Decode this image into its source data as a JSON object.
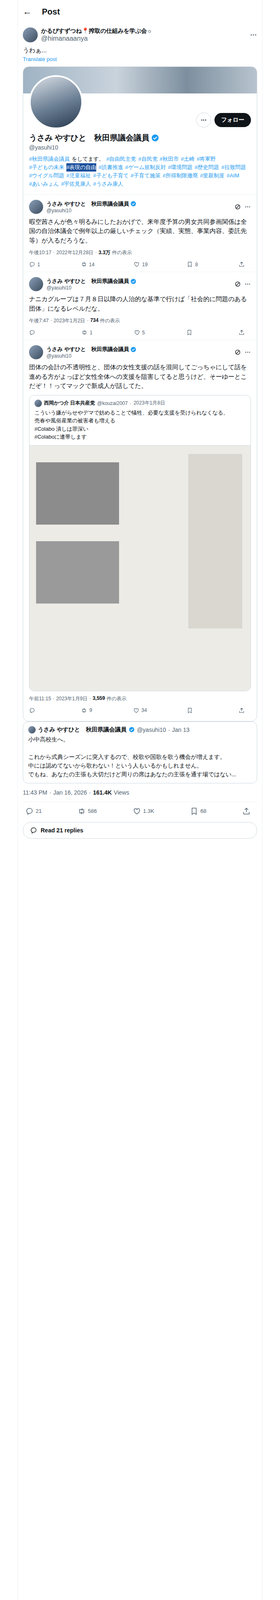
{
  "header": {
    "back": "←",
    "title": "Post"
  },
  "post": {
    "author": {
      "name": "かるぴすずつね📍搾取の仕組みを学ぶ会☼",
      "handle": "@himanaaanya"
    },
    "text": "うわぁ...",
    "translate": "Translate post",
    "embed": {
      "profile": {
        "name": "うさみ やすひと　秋田県議会議員",
        "verified": true,
        "handle": "@yasuhi10",
        "follow": "フォロー",
        "bio": [
          {
            "text": "#秋田県議会議員",
            "kind": "hashtag",
            "selected": false
          },
          {
            "text": "をしてます。",
            "kind": "plain",
            "selected": false
          },
          {
            "text": "#自由民主党",
            "kind": "hashtag",
            "selected": false
          },
          {
            "text": "#自民党",
            "kind": "hashtag",
            "selected": false
          },
          {
            "text": "#秋田市",
            "kind": "hashtag",
            "selected": false
          },
          {
            "text": "#土崎",
            "kind": "hashtag",
            "selected": false
          },
          {
            "text": "#将軍野",
            "kind": "hashtag",
            "selected": false
          },
          {
            "text": "#子どもの未来",
            "kind": "hashtag",
            "selected": false
          },
          {
            "text": "#表現の自由",
            "kind": "hashtag",
            "selected": true
          },
          {
            "text": "#読書推進",
            "kind": "hashtag",
            "selected": false
          },
          {
            "text": "#ゲーム規制反対",
            "kind": "hashtag",
            "selected": false
          },
          {
            "text": "#環境問題",
            "kind": "hashtag",
            "selected": false
          },
          {
            "text": "#歴史問題",
            "kind": "hashtag",
            "selected": false
          },
          {
            "text": "#拉致問題",
            "kind": "hashtag",
            "selected": false
          },
          {
            "text": "#ウイグル問題",
            "kind": "hashtag",
            "selected": false
          },
          {
            "text": "#児童福祉",
            "kind": "hashtag",
            "selected": false
          },
          {
            "text": "#子ども子育て",
            "kind": "hashtag",
            "selected": false
          },
          {
            "text": "#子育て施策",
            "kind": "hashtag",
            "selected": false
          },
          {
            "text": "#所得制限撤廃",
            "kind": "hashtag",
            "selected": false
          },
          {
            "text": "#里親制度",
            "kind": "hashtag",
            "selected": false
          },
          {
            "text": "#AIM",
            "kind": "hashtag",
            "selected": false
          },
          {
            "text": "#あいみょん",
            "kind": "hashtag",
            "selected": false
          },
          {
            "text": "#宇佐見康人",
            "kind": "hashtag",
            "selected": false
          },
          {
            "text": "#うさみ康人",
            "kind": "hashtag",
            "selected": false
          }
        ]
      },
      "tweets": [
        {
          "name": "うさみ やすひと　秋田県議会議員",
          "verified": true,
          "handle": "@yasuhi10",
          "text": "暇空茜さんが色々明るみにしたおかげで、来年度予算の男女共同参画関係は全国の自治体議会で例年以上の厳しいチェック（実績、実態、事業内容、委託先等）が入るだろうな。",
          "meta": [
            "午後10:17",
            "·",
            "2022年12月28日",
            "·"
          ],
          "views": "3.3万",
          "views_label": "件の表示",
          "quote": null,
          "actions": [
            {
              "kind": "reply",
              "count": "1"
            },
            {
              "kind": "repost",
              "count": "14"
            },
            {
              "kind": "like",
              "count": "19"
            },
            {
              "kind": "bookmark",
              "count": "8"
            },
            {
              "kind": "share",
              "count": ""
            }
          ]
        },
        {
          "name": "うさみ やすひと　秋田県議会議員",
          "verified": true,
          "handle": "@yasuhi10",
          "text": "ナニカグループは７月８日以降の人治的な基準で行けば「社会的に問題のある団体」になるレベルだな。",
          "meta": [
            "午後7:47",
            "·",
            "2023年1月2日",
            "·"
          ],
          "views": "734",
          "views_label": "件の表示",
          "quote": null,
          "actions": [
            {
              "kind": "reply",
              "count": ""
            },
            {
              "kind": "repost",
              "count": "1"
            },
            {
              "kind": "like",
              "count": "5"
            },
            {
              "kind": "bookmark",
              "count": ""
            },
            {
              "kind": "share",
              "count": ""
            }
          ]
        },
        {
          "name": "うさみ やすひと　秋田県議会議員",
          "verified": true,
          "handle": "@yasuhi10",
          "text": "団体の会計の不透明性と、団体の女性支援の話を混同してごっちゃにして話を進める方がよっぽど女性全体への支援を阻害してると思うけど、そーゆーとこだぞ！！ってマックで新成人が話してた。",
          "meta": [
            "午前11:15",
            "·",
            "2023年1月9日",
            "·"
          ],
          "views": "3,559",
          "views_label": "件の表示",
          "quote": {
            "name": "西岡かつ介 日本共産党",
            "handle": "@kouzai2007",
            "sep": "·",
            "date": "2023年1月8日",
            "text": "こういう嫌がらせやデマで妨めることで犠牲、必要な支援を受けられなくなる。\n売春や風俗産業の被害者も増える\n#Colabo 潰しは罪深い\n#Colaboに連帯します"
          },
          "actions": [
            {
              "kind": "reply",
              "count": ""
            },
            {
              "kind": "repost",
              "count": "9"
            },
            {
              "kind": "like",
              "count": "34"
            },
            {
              "kind": "bookmark",
              "count": ""
            },
            {
              "kind": "share",
              "count": ""
            }
          ]
        }
      ]
    },
    "quote": {
      "name": "うさみ やすひと　秋田県議会議員",
      "verified": true,
      "handle": "@yasuhi10",
      "sep": "·",
      "date": "Jan 13",
      "text": "小中高校生へ。\n\nこれから式典シーズンに突入するので、校歌や国歌を歌う機会が増えます。\n中には認めてないから歌わない！という人もいるかもしれません。\nでもね、あなたの主張も大切だけど周りの席はあなたの主張を通す場ではない..."
    },
    "meta": [
      "11:43 PM",
      "·",
      "Jan 16, 2026",
      "·"
    ],
    "views": "161.4K",
    "views_label": "Views",
    "actions": [
      {
        "kind": "reply",
        "count": "21"
      },
      {
        "kind": "repost",
        "count": "586"
      },
      {
        "kind": "like",
        "count": "1.3K"
      },
      {
        "kind": "bookmark",
        "count": "68"
      },
      {
        "kind": "share",
        "count": ""
      }
    ],
    "replies_button": "Read 21 replies"
  }
}
